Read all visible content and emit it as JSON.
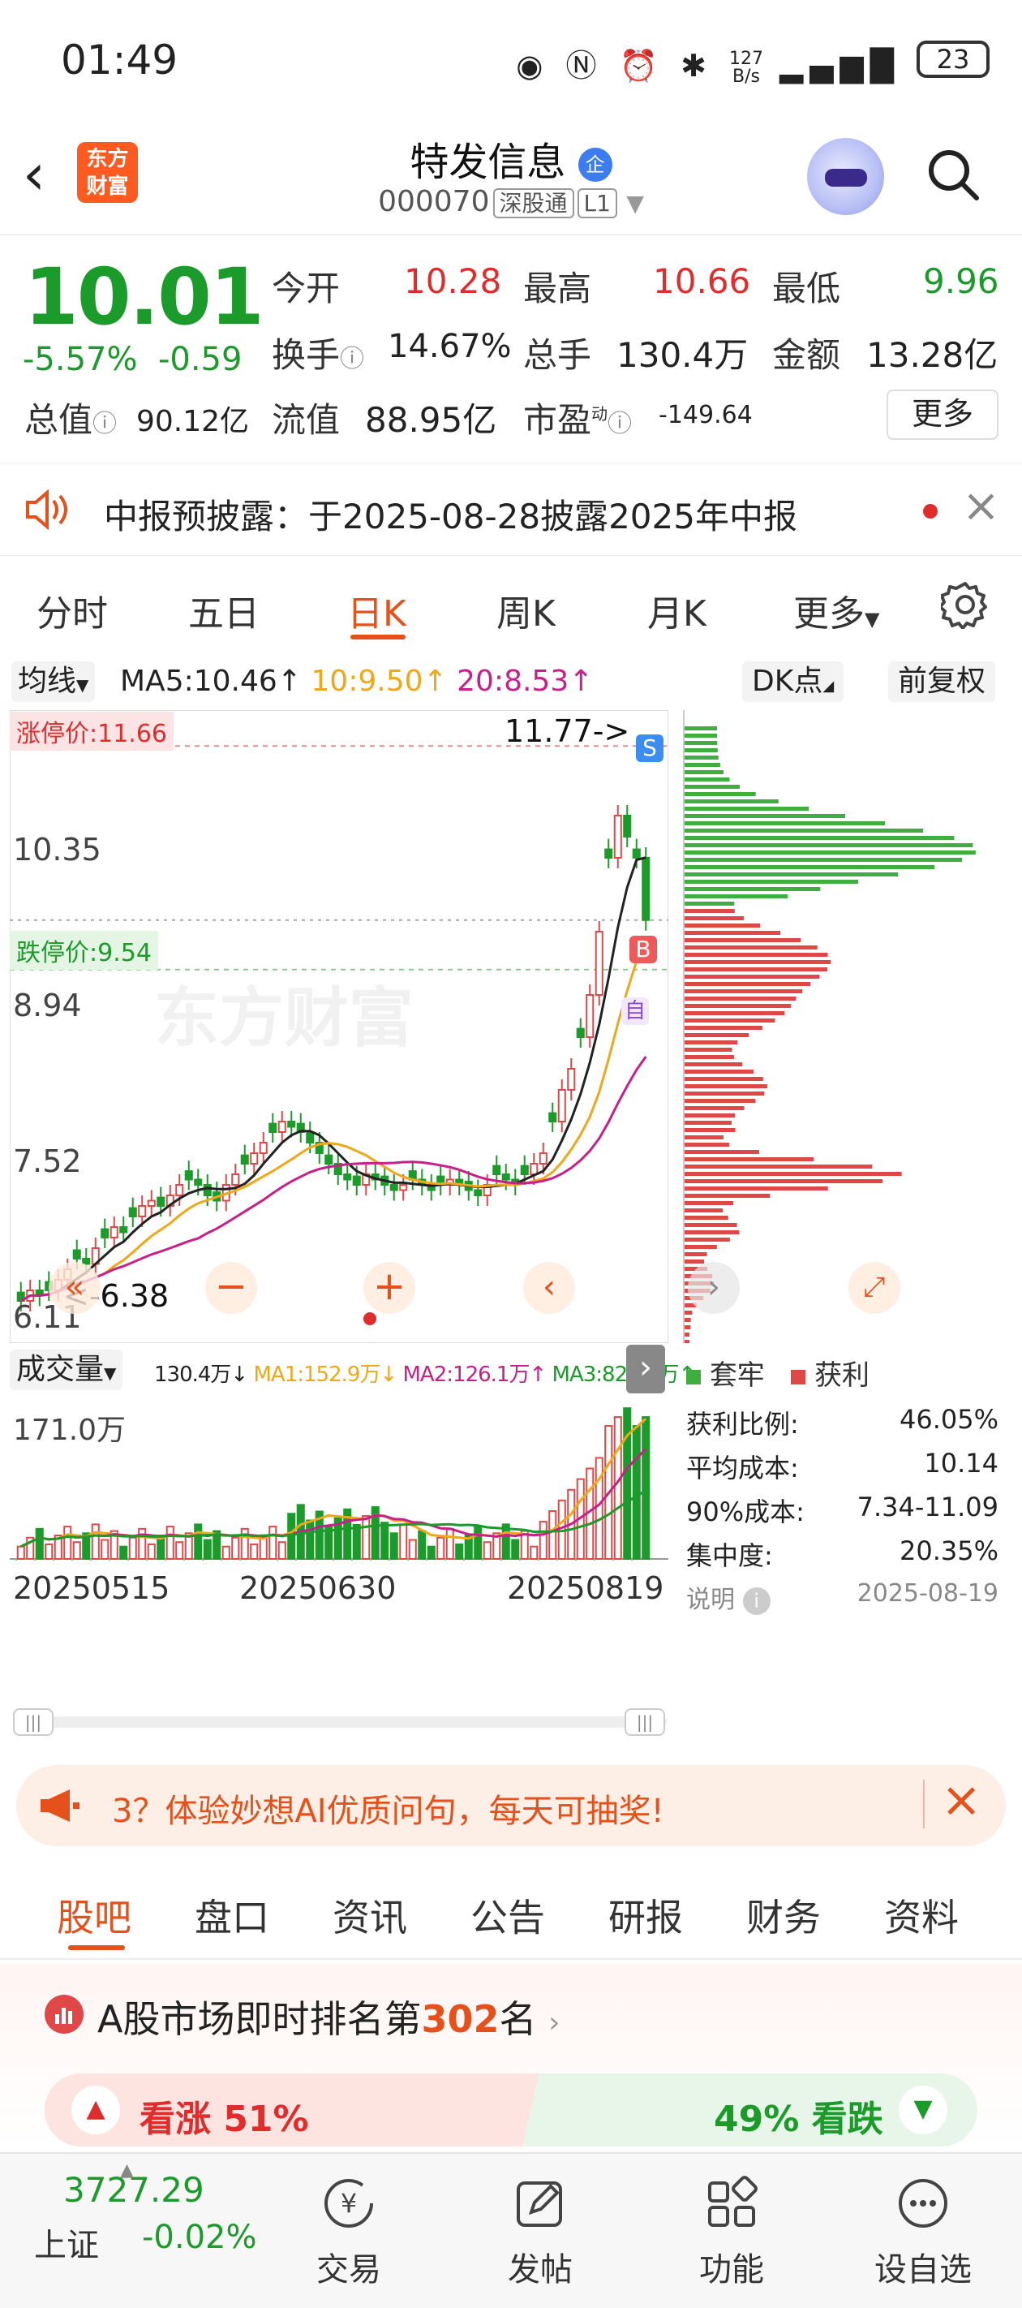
{
  "status_bar": {
    "time": "01:49",
    "net_speed_top": "127",
    "net_speed_unit": "B/s",
    "battery": "23"
  },
  "header": {
    "stock_name": "特发信息",
    "badge": "企",
    "code": "000070",
    "tags": [
      "深股通",
      "L1"
    ],
    "logo_lines": [
      "东方",
      "财富"
    ]
  },
  "quote": {
    "price": "10.01",
    "change_pct": "-5.57%",
    "change_abs": "-0.59",
    "open_label": "今开",
    "open": "10.28",
    "high_label": "最高",
    "high": "10.66",
    "low_label": "最低",
    "low": "9.96",
    "turnover_label": "换手",
    "turnover": "14.67%",
    "volume_label": "总手",
    "volume": "130.4万",
    "amount_label": "金额",
    "amount": "13.28亿",
    "mktcap_label": "总值",
    "mktcap": "90.12亿",
    "float_label": "流值",
    "float": "88.95亿",
    "pe_label": "市盈",
    "pe_sup": "动",
    "pe": "-149.64",
    "more_button": "更多"
  },
  "notice": {
    "text": "中报预披露：于2025-08-28披露2025年中报"
  },
  "kline_tabs": [
    "分时",
    "五日",
    "日K",
    "周K",
    "月K",
    "更多"
  ],
  "kline_active": "日K",
  "chart_toolbar": {
    "ma_select": "均线",
    "ma5": "MA5:10.46↑",
    "ma10": "10:9.50↑",
    "ma20": "20:8.53↑",
    "dk_button": "DK点",
    "fq_button": "前复权"
  },
  "chart_labels": {
    "limit_up": "涨停价:11.66",
    "limit_down": "跌停价:9.54",
    "max_marker": "11.77->",
    "min_marker": "<-6.38",
    "y_ticks": [
      "10.35",
      "8.94",
      "7.52",
      "6.11"
    ],
    "watermark": "东方财富",
    "s_marker": "S",
    "b_marker": "B",
    "self_marker": "自"
  },
  "volume_toolbar": {
    "select": "成交量",
    "vol": "130.4万↓",
    "ma1": "MA1:152.9万↓",
    "ma2": "MA2:126.1万↑",
    "ma3": "MA3:82.11万↑",
    "max_label": "171.0万"
  },
  "x_dates": [
    "20250515",
    "20250630",
    "20250819"
  ],
  "chip": {
    "legend_trapped": "套牢",
    "legend_profit": "获利",
    "rows": [
      {
        "label": "获利比例:",
        "value": "46.05%"
      },
      {
        "label": "平均成本:",
        "value": "10.14"
      },
      {
        "label": "90%成本:",
        "value": "7.34-11.09"
      },
      {
        "label": "集中度:",
        "value": "20.35%"
      }
    ],
    "note_label": "说明",
    "date": "2025-08-19"
  },
  "ad": {
    "text": "3？体验妙想AI优质问句，每天可抽奖!"
  },
  "bottom_tabs": [
    "股吧",
    "盘口",
    "资讯",
    "公告",
    "研报",
    "财务",
    "资料"
  ],
  "bottom_tab_active": "股吧",
  "rank": {
    "title_prefix": "A股市场即时排名第",
    "rank": "302",
    "title_suffix": "名",
    "up_label": "看涨 51%",
    "down_label": "49% 看跌",
    "up_pct": 0.51
  },
  "nav": {
    "index_value": "3727.29",
    "index_name": "上证",
    "index_change": "-0.02%",
    "items": [
      "交易",
      "发帖",
      "功能",
      "设自选"
    ]
  },
  "chart_data": {
    "type": "candlestick",
    "y_ticks": [
      10.35,
      8.94,
      7.52,
      6.11
    ],
    "x_ticks": [
      "20250515",
      "20250630",
      "20250819"
    ],
    "close_series_approx": [
      6.4,
      6.5,
      6.45,
      6.5,
      6.6,
      6.7,
      6.8,
      6.75,
      6.9,
      7.0,
      7.1,
      7.05,
      7.2,
      7.3,
      7.35,
      7.3,
      7.4,
      7.5,
      7.55,
      7.5,
      7.4,
      7.35,
      7.5,
      7.6,
      7.7,
      7.8,
      7.9,
      8.0,
      8.1,
      8.05,
      8.0,
      7.9,
      7.8,
      7.7,
      7.6,
      7.55,
      7.5,
      7.6,
      7.55,
      7.5,
      7.45,
      7.5,
      7.55,
      7.5,
      7.45,
      7.5,
      7.55,
      7.5,
      7.45,
      7.4,
      7.5,
      7.6,
      7.55,
      7.5,
      7.6,
      7.7,
      7.8,
      8.1,
      8.4,
      8.6,
      8.9,
      9.3,
      9.9,
      10.6,
      11.0,
      10.8,
      10.6,
      10.01
    ],
    "ma5": 10.46,
    "ma10": 9.5,
    "ma20": 8.53,
    "limit_up": 11.66,
    "limit_down": 9.54,
    "high_marker": 11.77,
    "low_marker": 6.38
  }
}
